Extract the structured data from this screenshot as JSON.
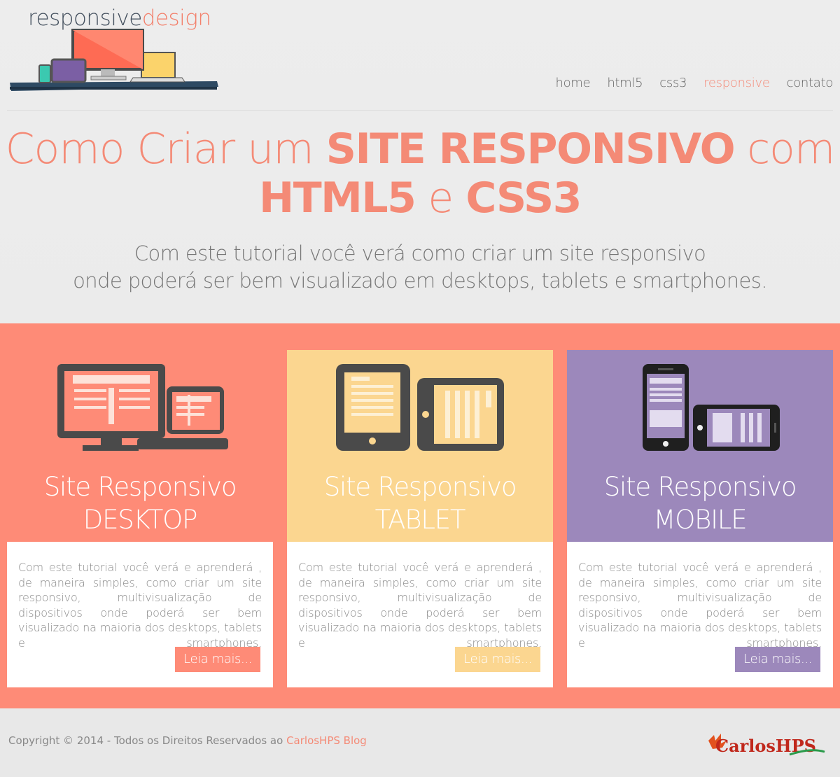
{
  "header": {
    "logo_part1": "responsive",
    "logo_part2": "design",
    "nav": [
      {
        "label": "home",
        "active": false
      },
      {
        "label": "html5",
        "active": false
      },
      {
        "label": "css3",
        "active": false
      },
      {
        "label": "responsive",
        "active": true
      },
      {
        "label": "contato",
        "active": false
      }
    ]
  },
  "hero": {
    "t1": "Como Criar um ",
    "t2": "SITE RESPONSIVO",
    "t3": " com",
    "t4": "HTML5",
    "t5": " e ",
    "t6": "CSS3",
    "sub1": "Com este tutorial você verá como criar um site responsivo",
    "sub2": "onde poderá ser bem visualizado em desktops, tablets e smartphones."
  },
  "cards": [
    {
      "title1": "Site Responsivo",
      "title2": "DESKTOP",
      "text": "Com este tutorial você verá e aprenderá , de maneira simples, como criar um site responsivo, multivisualização de dispositivos onde poderá ser bem visualizado na maioria dos desktops, tablets e smartphones.",
      "button": "Leia mais..."
    },
    {
      "title1": "Site Responsivo",
      "title2": "TABLET",
      "text": "Com este tutorial você verá e aprenderá , de maneira simples, como criar um site responsivo, multivisualização de dispositivos onde poderá ser bem visualizado na maioria dos desktops, tablets e smartphones.",
      "button": "Leia mais..."
    },
    {
      "title1": "Site Responsivo",
      "title2": "MOBILE",
      "text": "Com este tutorial você verá e aprenderá , de maneira simples, como criar um site responsivo, multivisualização de dispositivos onde poderá ser bem visualizado na maioria dos desktops, tablets e smartphones.",
      "button": "Leia mais..."
    }
  ],
  "footer": {
    "copyright": "Copyright © 2014 - Todos os Direitos Reservados ao ",
    "link": "CarlosHPS Blog",
    "brand": "CarlosHPS"
  },
  "colors": {
    "coral": "#fe8b77",
    "yellow": "#fbd690",
    "purple": "#9c88bb",
    "dark": "#4a4a4a"
  },
  "icons": [
    "desktop-illustration-icon",
    "tablet-illustration-icon",
    "mobile-illustration-icon",
    "logo-devices-icon"
  ]
}
